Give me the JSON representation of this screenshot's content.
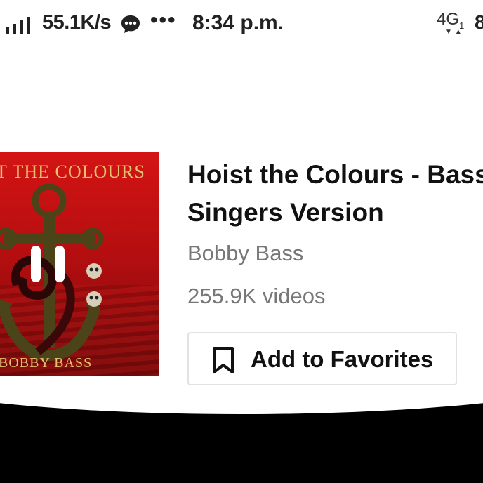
{
  "status_bar": {
    "net_speed": "55.1K/s",
    "more": "•••",
    "time": "8:34 p.m.",
    "network": "4G",
    "network_sub": "1",
    "battery_peek": "8",
    "icons": [
      "signal-icon",
      "chat-bubble-icon",
      "lte-icon"
    ]
  },
  "cover": {
    "title_text": "T THE COLOURS",
    "artist_text": "BOBBY BASS",
    "overlay_icon": "pause-icon"
  },
  "song": {
    "title": "Hoist the Colours - Bass Singers Version",
    "artist": "Bobby Bass",
    "video_count": "255.9K videos"
  },
  "actions": {
    "favorite_label": "Add to Favorites",
    "favorite_icon": "bookmark-icon"
  },
  "colors": {
    "cover_red": "#c81214",
    "cover_gold": "#e4c070",
    "title_text": "#111111",
    "secondary_text": "#777777"
  }
}
